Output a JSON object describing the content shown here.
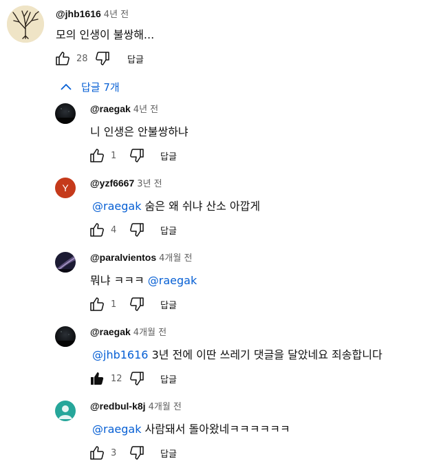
{
  "top_comment": {
    "author": "@jhb1616",
    "time": "4년 전",
    "text": "모의 인생이 불쌍해...",
    "likes": "28",
    "reply_label": "답글"
  },
  "replies_toggle": {
    "label": "답글 7개"
  },
  "replies": [
    {
      "author": "@raegak",
      "time": "4년 전",
      "mention": "",
      "text": "니 인생은 안불쌍하냐",
      "likes": "1",
      "reply_label": "답글",
      "avatar": "night-sky",
      "liked": false
    },
    {
      "author": "@yzf6667",
      "time": "3년 전",
      "mention": "@raegak",
      "text": "숨은 왜 쉬냐 산소 아깝게",
      "likes": "4",
      "reply_label": "답글",
      "avatar": "letter",
      "avatar_letter": "Y",
      "avatar_color": "#c53a1b",
      "liked": false
    },
    {
      "author": "@paralvientos",
      "time": "4개월 전",
      "mention": "",
      "text": "뭐냐 ㅋㅋㅋ",
      "mention_after": "@raegak",
      "likes": "1",
      "reply_label": "답글",
      "avatar": "milky-way",
      "liked": false
    },
    {
      "author": "@raegak",
      "time": "4개월 전",
      "mention": "@jhb1616",
      "text": "3년 전에 이딴 쓰레기 댓글을 달았네요 죄송합니다",
      "likes": "12",
      "reply_label": "답글",
      "avatar": "night-sky",
      "liked": true
    },
    {
      "author": "@redbul-k8j",
      "time": "4개월 전",
      "mention": "@raegak",
      "text": "사람돼서 돌아왔네ㅋㅋㅋㅋㅋㅋ",
      "likes": "3",
      "reply_label": "답글",
      "avatar": "default-person",
      "avatar_color": "#26a69a",
      "liked": false
    }
  ]
}
